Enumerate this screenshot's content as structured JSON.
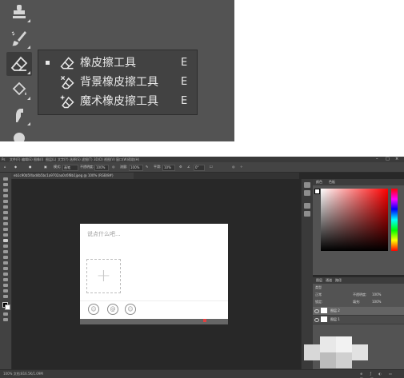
{
  "flyout": {
    "items": [
      {
        "label": "橡皮擦工具",
        "shortcut": "E",
        "icon": "eraser-icon",
        "active": true
      },
      {
        "label": "背景橡皮擦工具",
        "shortcut": "E",
        "icon": "background-eraser-icon",
        "active": false
      },
      {
        "label": "魔术橡皮擦工具",
        "shortcut": "E",
        "icon": "magic-eraser-icon",
        "active": false
      }
    ]
  },
  "toolstrip_top": {
    "tools": [
      "stamp-icon",
      "history-brush-icon",
      "eraser-icon",
      "paint-bucket-icon",
      "smudge-icon",
      "dodge-icon"
    ]
  },
  "photoshop": {
    "menu": [
      "文件(F)",
      "编辑(E)",
      "图像(I)",
      "图层(L)",
      "文字(Y)",
      "选择(S)",
      "滤镜(T)",
      "3D(D)",
      "视图(V)",
      "窗口(W)",
      "帮助(H)"
    ],
    "options": {
      "mode_label": "模式:",
      "mode_value": "画笔",
      "opacity_label": "不透明度:",
      "opacity_value": "100%",
      "flow_label": "流量:",
      "flow_value": "100%",
      "smoothing_label": "平滑:",
      "smoothing_value": "10%",
      "angle_value": "0°"
    },
    "doc_tab": "eb1c90b5f4ad4b5bc1a9702aa0c6f8b1jpeg @ 100% (RGB/8#)",
    "document": {
      "placeholder": "说点什么吧...",
      "plus_glyph": "+",
      "emoji_icons": [
        "☺",
        "@",
        "☺"
      ]
    },
    "color_panel": {
      "tabs": [
        "颜色",
        "色板"
      ]
    },
    "layers_panel": {
      "tabs": [
        "图层",
        "通道",
        "路径"
      ],
      "filter_label": "类型",
      "blend": "正常",
      "opacity_label": "不透明度:",
      "opacity_value": "100%",
      "lock_label": "锁定:",
      "fill_label": "填充:",
      "fill_value": "100%",
      "layers": [
        {
          "name": "图层 2",
          "selected": true
        },
        {
          "name": "图层 1",
          "selected": false
        }
      ]
    },
    "status": "100%    文档:816.5K/1.09M"
  },
  "colors": {
    "ps_bg": "#282828",
    "panel": "#535353",
    "flyout_bg": "#424242"
  }
}
